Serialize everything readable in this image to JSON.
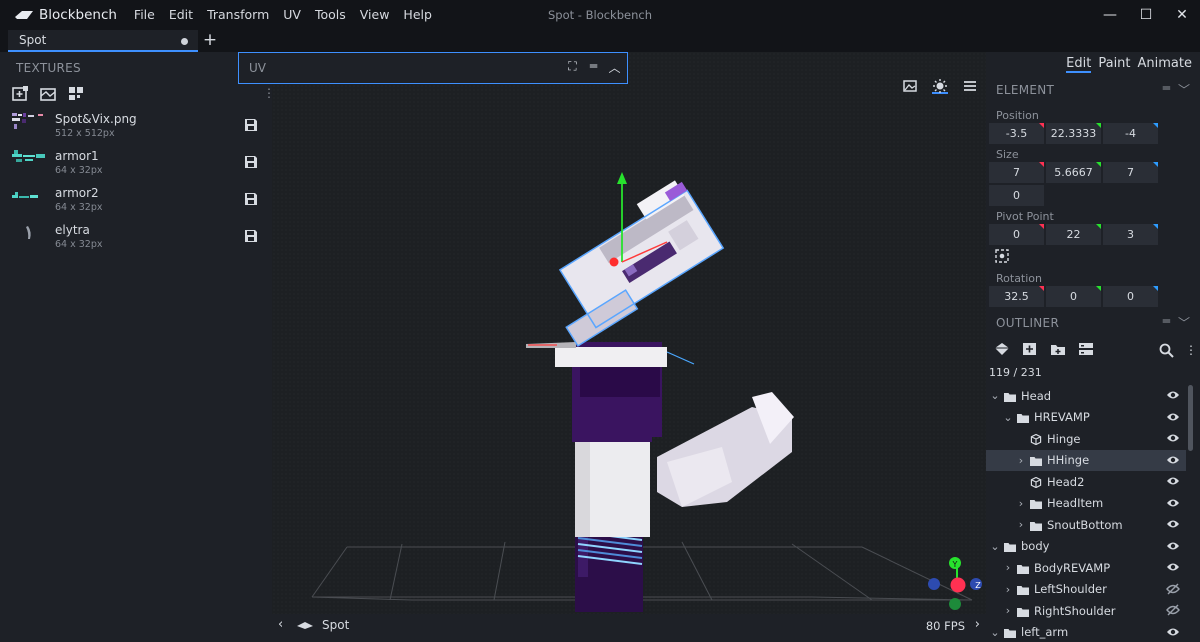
{
  "app": {
    "name": "Blockbench",
    "window_title": "Spot - Blockbench"
  },
  "menu": [
    "File",
    "Edit",
    "Transform",
    "UV",
    "Tools",
    "View",
    "Help"
  ],
  "window_controls": [
    "—",
    "☐",
    "✕"
  ],
  "tabs": [
    {
      "label": "Spot",
      "modified": true
    }
  ],
  "new_tab": "+",
  "textures_panel": {
    "title": "TEXTURES",
    "items": [
      {
        "name": "Spot&Vix.png",
        "size": "512 x 512px"
      },
      {
        "name": "armor1",
        "size": "64 x 32px"
      },
      {
        "name": "armor2",
        "size": "64 x 32px"
      },
      {
        "name": "elytra",
        "size": "64 x 32px"
      }
    ]
  },
  "uv_panel": {
    "label": "UV"
  },
  "modes": [
    "Edit",
    "Paint",
    "Animate"
  ],
  "active_mode": "Edit",
  "element_panel": {
    "title": "ELEMENT",
    "position": {
      "label": "Position",
      "values": [
        "-3.5",
        "22.3333",
        "-4"
      ]
    },
    "size": {
      "label": "Size",
      "values": [
        "7",
        "5.6667",
        "7"
      ],
      "inflate": "0"
    },
    "pivot": {
      "label": "Pivot Point",
      "values": [
        "0",
        "22",
        "3"
      ]
    },
    "rotation": {
      "label": "Rotation",
      "values": [
        "32.5",
        "0",
        "0"
      ]
    }
  },
  "outliner": {
    "title": "OUTLINER",
    "count": "119 / 231",
    "items": [
      {
        "label": "Head",
        "type": "folder",
        "depth": 0,
        "expanded": true
      },
      {
        "label": "HREVAMP",
        "type": "folder",
        "depth": 1,
        "expanded": true
      },
      {
        "label": "Hinge",
        "type": "cube",
        "depth": 2
      },
      {
        "label": "HHinge",
        "type": "folder",
        "depth": 2,
        "expanded": false,
        "selected": true
      },
      {
        "label": "Head2",
        "type": "cube",
        "depth": 2
      },
      {
        "label": "HeadItem",
        "type": "folder",
        "depth": 2,
        "expanded": false
      },
      {
        "label": "SnoutBottom",
        "type": "folder",
        "depth": 2,
        "expanded": false
      },
      {
        "label": "body",
        "type": "folder",
        "depth": 0,
        "expanded": true
      },
      {
        "label": "BodyREVAMP",
        "type": "folder",
        "depth": 1,
        "expanded": false
      },
      {
        "label": "LeftShoulder",
        "type": "folder",
        "depth": 1,
        "expanded": false,
        "hidden": true
      },
      {
        "label": "RightShoulder",
        "type": "folder",
        "depth": 1,
        "expanded": false,
        "hidden": true
      },
      {
        "label": "left_arm",
        "type": "folder",
        "depth": 0,
        "expanded": true
      }
    ]
  },
  "viewport": {
    "scene_name": "Spot",
    "fps": "80 FPS"
  },
  "colors": {
    "accent": "#3e90ff",
    "axis_x": "#ff3152",
    "axis_y": "#27e22d",
    "axis_z": "#2d9cff",
    "purple": "#3a1460"
  }
}
